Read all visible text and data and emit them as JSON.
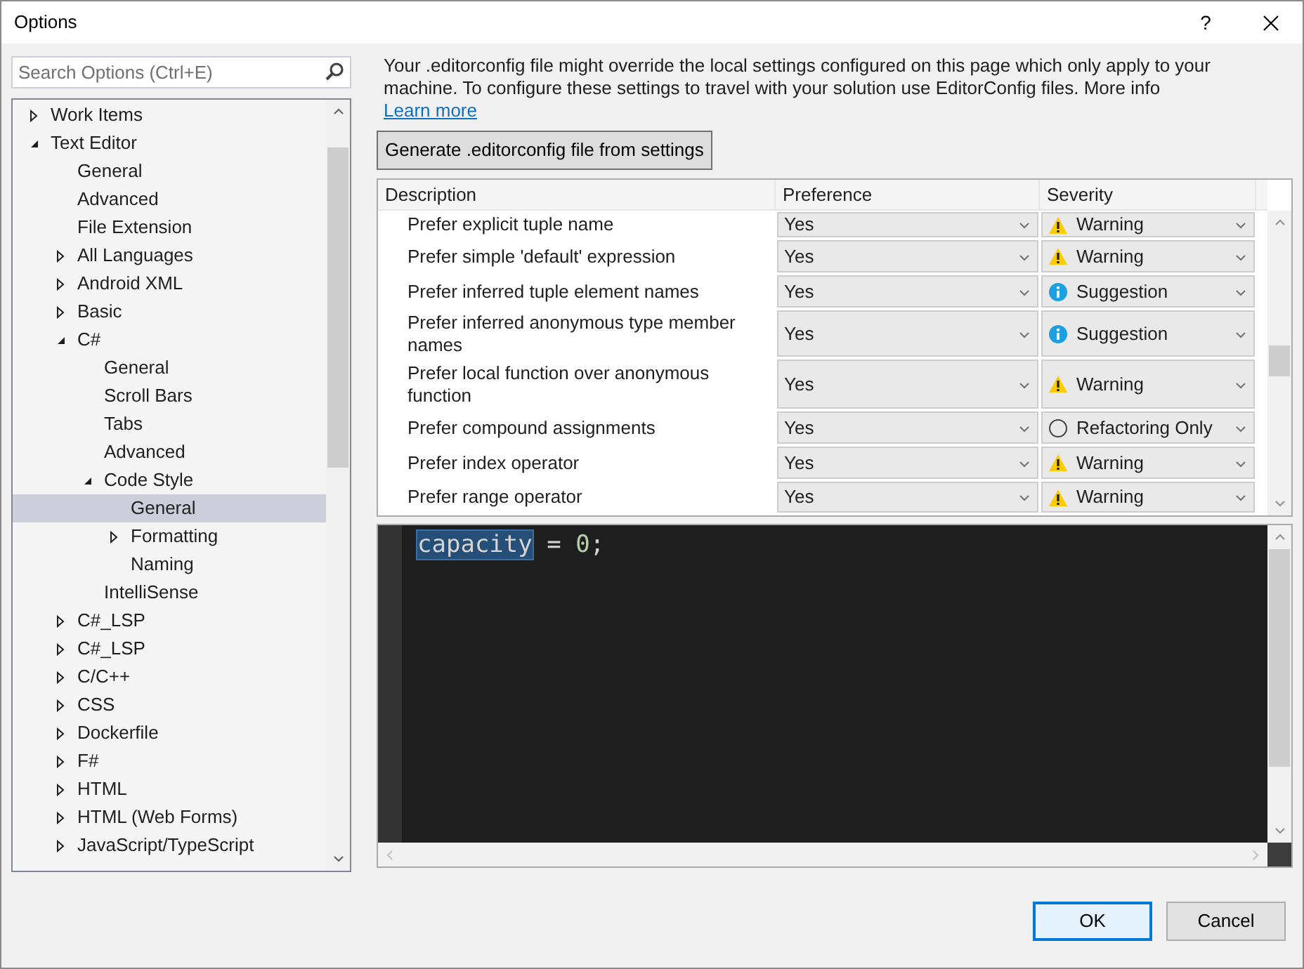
{
  "window": {
    "title": "Options",
    "help": "?"
  },
  "search": {
    "placeholder": "Search Options (Ctrl+E)"
  },
  "tree": [
    {
      "label": "Work Items",
      "expanded": false,
      "selected": false
    },
    {
      "label": "Text Editor",
      "expanded": true,
      "selected": false,
      "children": [
        {
          "label": "General",
          "selected": false
        },
        {
          "label": "Advanced",
          "selected": false
        },
        {
          "label": "File Extension",
          "selected": false
        },
        {
          "label": "All Languages",
          "expanded": false,
          "selected": false
        },
        {
          "label": "Android XML",
          "expanded": false,
          "selected": false
        },
        {
          "label": "Basic",
          "expanded": false,
          "selected": false
        },
        {
          "label": "C#",
          "expanded": true,
          "selected": false,
          "children": [
            {
              "label": "General",
              "selected": false
            },
            {
              "label": "Scroll Bars",
              "selected": false
            },
            {
              "label": "Tabs",
              "selected": false
            },
            {
              "label": "Advanced",
              "selected": false
            },
            {
              "label": "Code Style",
              "expanded": true,
              "selected": false,
              "children": [
                {
                  "label": "General",
                  "selected": true
                },
                {
                  "label": "Formatting",
                  "expanded": false,
                  "selected": false
                },
                {
                  "label": "Naming",
                  "selected": false
                }
              ]
            },
            {
              "label": "IntelliSense",
              "selected": false
            }
          ]
        },
        {
          "label": "C#_LSP",
          "expanded": false,
          "selected": false
        },
        {
          "label": "C#_LSP",
          "expanded": false,
          "selected": false
        },
        {
          "label": "C/C++",
          "expanded": false,
          "selected": false
        },
        {
          "label": "CSS",
          "expanded": false,
          "selected": false
        },
        {
          "label": "Dockerfile",
          "expanded": false,
          "selected": false
        },
        {
          "label": "F#",
          "expanded": false,
          "selected": false
        },
        {
          "label": "HTML",
          "expanded": false,
          "selected": false
        },
        {
          "label": "HTML (Web Forms)",
          "expanded": false,
          "selected": false
        },
        {
          "label": "JavaScript/TypeScript",
          "expanded": false,
          "selected": false
        }
      ]
    }
  ],
  "info": {
    "text": "Your .editorconfig file might override the local settings configured on this page which only apply to your machine. To configure these settings to travel with your solution use EditorConfig files. More info",
    "link": "Learn more"
  },
  "generate_button": "Generate .editorconfig file from settings",
  "table": {
    "columns": [
      "Description",
      "Preference",
      "Severity"
    ],
    "rows": [
      {
        "description": "Prefer explicit tuple name",
        "preference": "Yes",
        "severity": "Warning",
        "kind": "warning"
      },
      {
        "description": "Prefer simple 'default' expression",
        "preference": "Yes",
        "severity": "Warning",
        "kind": "warning"
      },
      {
        "description": "Prefer inferred tuple element names",
        "preference": "Yes",
        "severity": "Suggestion",
        "kind": "suggestion"
      },
      {
        "description": "Prefer inferred anonymous type member names",
        "preference": "Yes",
        "severity": "Suggestion",
        "kind": "suggestion"
      },
      {
        "description": "Prefer local function over anonymous function",
        "preference": "Yes",
        "severity": "Warning",
        "kind": "warning"
      },
      {
        "description": "Prefer compound assignments",
        "preference": "Yes",
        "severity": "Refactoring Only",
        "kind": "refactoring"
      },
      {
        "description": "Prefer index operator",
        "preference": "Yes",
        "severity": "Warning",
        "kind": "warning"
      },
      {
        "description": "Prefer range operator",
        "preference": "Yes",
        "severity": "Warning",
        "kind": "warning"
      }
    ]
  },
  "code": [
    {
      "text": "capacity",
      "kind": "selected"
    },
    {
      "text": " = ",
      "kind": "plain"
    },
    {
      "text": "0",
      "kind": "number"
    },
    {
      "text": ";",
      "kind": "plain"
    }
  ],
  "buttons": [
    {
      "label": "OK",
      "kind": "default"
    },
    {
      "label": "Cancel",
      "kind": "normal"
    }
  ]
}
